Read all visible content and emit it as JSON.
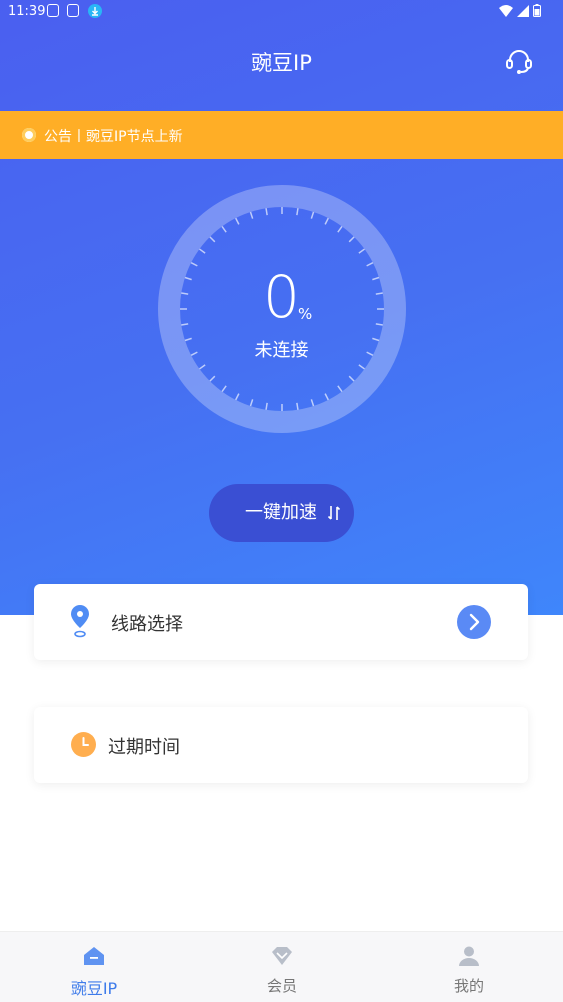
{
  "status_bar": {
    "time": "11:39"
  },
  "header": {
    "title": "豌豆IP",
    "support_icon": "headset-icon"
  },
  "notice": {
    "text": "公告丨豌豆IP节点上新"
  },
  "connection": {
    "percent": "0",
    "unit": "%",
    "status": "未连接",
    "progress": 0
  },
  "accelerate_button": {
    "label": "一键加速",
    "icon": "swap-vertical-icon"
  },
  "route_card": {
    "label": "线路选择",
    "icon": "location-pin-icon",
    "action_icon": "chevron-right-icon"
  },
  "expire_card": {
    "label": "过期时间",
    "icon": "clock-icon"
  },
  "tabbar": {
    "tabs": [
      {
        "label": "豌豆IP",
        "icon": "home-icon",
        "active": true
      },
      {
        "label": "会员",
        "icon": "diamond-icon",
        "active": false
      },
      {
        "label": "我的",
        "icon": "user-icon",
        "active": false
      }
    ]
  },
  "colors": {
    "primary": "#4a63f0",
    "notice_bg": "#ffae26",
    "accent_blue": "#3e7bea",
    "clock_orange": "#ffae4f"
  }
}
